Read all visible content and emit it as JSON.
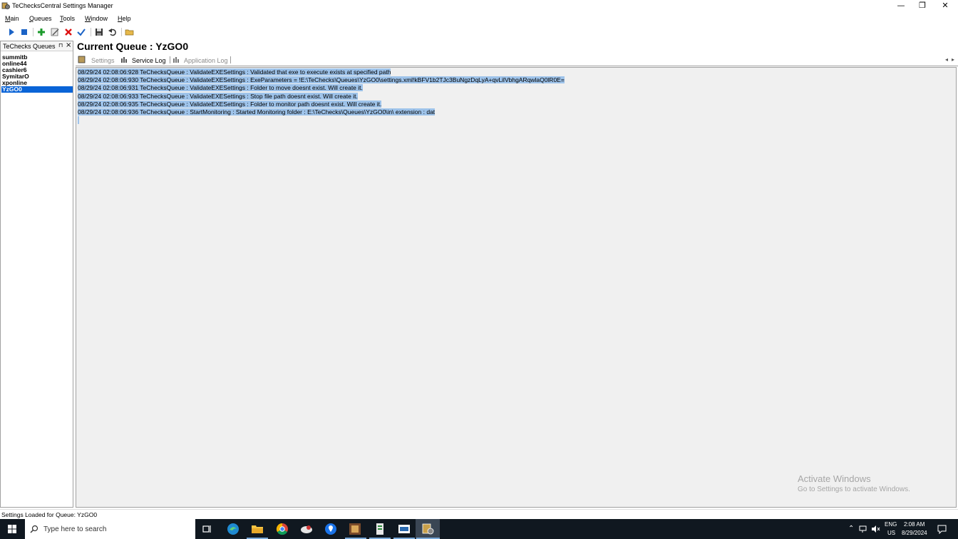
{
  "window": {
    "title": "TeChecksCentral Settings Manager",
    "app_icon": "app-icon",
    "controls": {
      "minimize": "—",
      "restore": "❐",
      "close": "✕"
    }
  },
  "menu": [
    {
      "label": "Main",
      "accel": "M",
      "rest": "ain"
    },
    {
      "label": "Queues",
      "accel": "Q",
      "rest": "ueues"
    },
    {
      "label": "Tools",
      "accel": "T",
      "rest": "ools"
    },
    {
      "label": "Window",
      "accel": "W",
      "rest": "indow"
    },
    {
      "label": "Help",
      "accel": "H",
      "rest": "elp"
    }
  ],
  "toolbar": {
    "icons": [
      "play-icon",
      "stop-icon",
      "add-icon",
      "edit-icon",
      "delete-icon",
      "check-icon",
      "save-icon",
      "undo-icon",
      "open-folder-icon"
    ]
  },
  "left_pane": {
    "title": "TeChecks Queues",
    "pin_glyph": "⊓",
    "close_glyph": "×",
    "queues": [
      "summitb",
      "online44",
      "cashier6",
      "SymitarO",
      "xponline",
      "YzGO0"
    ],
    "selected": "YzGO0"
  },
  "main": {
    "current_queue_label": "Current Queue : YzGO0",
    "tabs": [
      {
        "label": "Settings",
        "active": false
      },
      {
        "label": "Service Log",
        "active": true
      },
      {
        "label": "Application Log",
        "active": false
      }
    ],
    "log_lines": [
      "08/29/24 02:08:06:928 TeChecksQueue : ValidateEXESettings : Validated that exe to execute exists at specified path",
      "08/29/24 02:08:06:930 TeChecksQueue : ValidateEXESettings : ExeParameters = !E:\\TeChecks\\Queues\\YzGO0\\settings.xml!kBFV1b2TJc3BuNgzDqLyA+qvLilVbhgARqwlaQ0lR0E=",
      "08/29/24 02:08:06:931 TeChecksQueue : ValidateEXESettings : Folder to move doesnt exist. Will create it.",
      "08/29/24 02:08:06:933 TeChecksQueue : ValidateEXESettings : Stop file path doesnt exist. Will create it.",
      "08/29/24 02:08:06:935 TeChecksQueue : ValidateEXESettings : Folder to monitor path doesnt exist. Will create it.",
      "08/29/24 02:08:06:936 TeChecksQueue : StartMonitoring : Started Monitoring folder : E:\\TeChecks\\Queues\\YzGO0\\in\\ extension : dat"
    ]
  },
  "watermark": {
    "line1": "Activate Windows",
    "line2": "Go to Settings to activate Windows."
  },
  "status_bar": {
    "text": "Settings Loaded for Queue: YzGO0"
  },
  "taskbar": {
    "search_placeholder": "Type here to search",
    "apps": [
      "task-view-icon",
      "edge-icon",
      "file-explorer-icon",
      "chrome-icon",
      "app-icon-1",
      "maps-icon",
      "app-icon-2",
      "app-icon-3",
      "app-icon-4",
      "techecks-icon"
    ],
    "lang_top": "ENG",
    "lang_bottom": "US",
    "time": "2:08 AM",
    "date": "8/29/2024"
  },
  "colors": {
    "selection": "#0a64d7",
    "log_highlight": "#9ec3ea",
    "taskbar": "#101820"
  }
}
